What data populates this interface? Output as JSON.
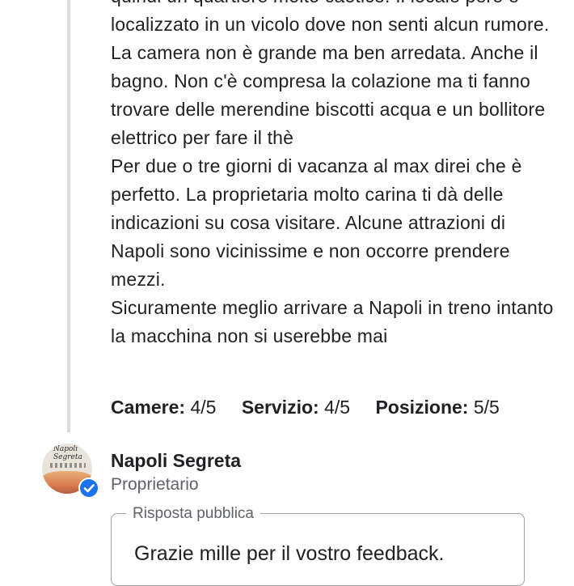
{
  "review": {
    "paragraphs": [
      "quindi un quartiere molto caotico. Il locale però è localizzato in un vicolo dove non senti alcun rumore.",
      "La camera non è grande ma ben arredata. Anche il bagno. Non c'è compresa la colazione ma ti fanno trovare delle merendine biscotti acqua e un bollitore elettrico per fare il thè",
      "Per due o tre giorni di vacanza al max direi che è perfetto. La proprietaria molto carina ti dà delle indicazioni su cosa visitare. Alcune attrazioni di Napoli sono vicinissime e non occorre prendere mezzi.",
      "Sicuramente meglio arrivare a Napoli in treno intanto la macchina non si userebbe mai"
    ],
    "ratings": [
      {
        "label": "Camere:",
        "value": "4/5"
      },
      {
        "label": "Servizio:",
        "value": "4/5"
      },
      {
        "label": "Posizione:",
        "value": "5/5"
      }
    ]
  },
  "owner": {
    "logo_text": "Napoli Segreta",
    "name": "Napoli Segreta",
    "role": "Proprietario",
    "verified_icon": "verified-check-icon",
    "badge_color": "#1a73e8"
  },
  "reply": {
    "legend": "Risposta pubblica",
    "text": "Grazie mille per il vostro feedback."
  }
}
